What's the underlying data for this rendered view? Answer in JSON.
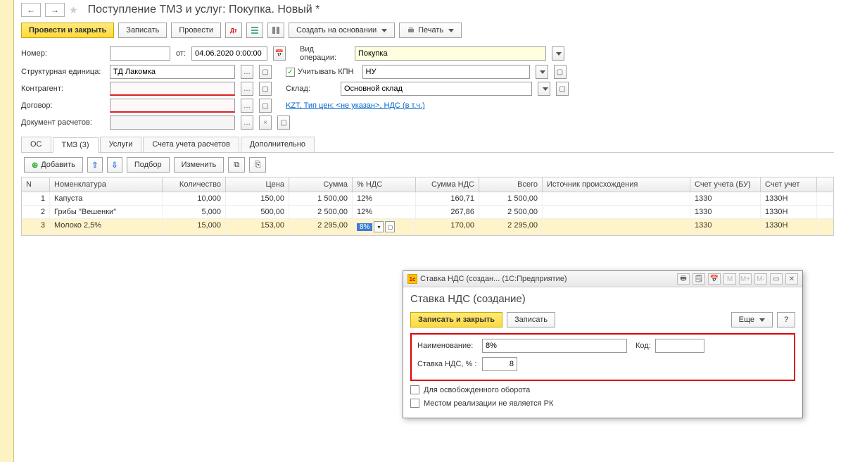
{
  "title": "Поступление ТМЗ и услуг: Покупка. Новый *",
  "toolbar": {
    "post_close": "Провести и закрыть",
    "save": "Записать",
    "post": "Провести",
    "create_on_basis": "Создать на основании",
    "print": "Печать"
  },
  "labels": {
    "number": "Номер:",
    "from": "от:",
    "operation_type": "Вид операции:",
    "structural_unit": "Структурная единица:",
    "include_kpn": "Учитывать КПН",
    "kpn": "НУ",
    "counterparty": "Контрагент:",
    "warehouse": "Склад:",
    "contract": "Договор:",
    "payment_doc": "Документ расчетов:"
  },
  "values": {
    "date": "04.06.2020 0:00:00",
    "operation_type": "Покупка",
    "structural_unit": "ТД Лакомка",
    "warehouse": "Основной склад",
    "price_info": "KZT, Тип цен: <не указан>, НДС (в т.ч.)"
  },
  "tabs": {
    "os": "ОС",
    "tmz": "ТМЗ (3)",
    "services": "Услуги",
    "accounts": "Счета учета расчетов",
    "additional": "Дополнительно"
  },
  "tab_toolbar": {
    "add": "Добавить",
    "select": "Подбор",
    "change": "Изменить"
  },
  "grid": {
    "headers": {
      "n": "N",
      "nomenclature": "Номенклатура",
      "quantity": "Количество",
      "price": "Цена",
      "sum": "Сумма",
      "vat_pct": "% НДС",
      "vat_sum": "Сумма НДС",
      "total": "Всего",
      "origin": "Источник происхождения",
      "account_bu": "Счет учета (БУ)",
      "account_nu": "Счет учет"
    },
    "rows": [
      {
        "n": "1",
        "nom": "Капуста",
        "qty": "10,000",
        "price": "150,00",
        "sum": "1 500,00",
        "vat": "12%",
        "vsum": "160,71",
        "total": "1 500,00",
        "origin": "",
        "acct": "1330",
        "acct2": "1330Н"
      },
      {
        "n": "2",
        "nom": "Грибы \"Вешенки\"",
        "qty": "5,000",
        "price": "500,00",
        "sum": "2 500,00",
        "vat": "12%",
        "vsum": "267,86",
        "total": "2 500,00",
        "origin": "",
        "acct": "1330",
        "acct2": "1330Н"
      },
      {
        "n": "3",
        "nom": "Молоко 2,5%",
        "qty": "15,000",
        "price": "153,00",
        "sum": "2 295,00",
        "vat": "8%",
        "vsum": "170,00",
        "total": "2 295,00",
        "origin": "",
        "acct": "1330",
        "acct2": "1330Н"
      }
    ]
  },
  "modal": {
    "win_title": "Ставка НДС (создан...   (1С:Предприятие)",
    "heading": "Ставка НДС (создание)",
    "save_close": "Записать и закрыть",
    "save": "Записать",
    "more": "Еще",
    "help": "?",
    "name_label": "Наименование:",
    "name_value": "8%",
    "code_label": "Код:",
    "rate_label": "Ставка НДС, % :",
    "rate_value": "8",
    "chk_freed": "Для освобожденного оборота",
    "chk_notrk": "Местом реализации не является РК"
  }
}
